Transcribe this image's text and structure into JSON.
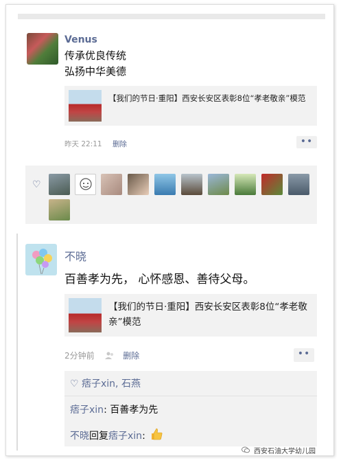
{
  "post1": {
    "username": "Venus",
    "text_line1": "传承优良传统",
    "text_line2": "弘扬中华美德",
    "link_title": "【我们的节日·重阳】西安长安区表彰8位“孝老敬亲”模范",
    "time": "昨天 22:11",
    "delete": "删除",
    "more": "••"
  },
  "likes1": {
    "icon": "heart-outline-icon",
    "count": 11
  },
  "post2": {
    "username": "不晓",
    "text": "百善孝为先， 心怀感恩、善待父母。",
    "link_title": "【我们的节日·重阳】西安长安区表彰8位“孝老敬亲”模范",
    "time": "2分钟前",
    "delete": "删除",
    "more": "••"
  },
  "comments": {
    "likes_text": "♡ 痞子xin, 石燕",
    "c1_name": "痞子xin",
    "c1_text": ": 百善孝为先",
    "c2_name1": "不晓",
    "c2_mid": "回复",
    "c2_name2": "痞子xin",
    "c2_colon": ":"
  },
  "watermark": "西安石油大学幼儿园",
  "colors": {
    "name_link": "#5b6b94",
    "panel_bg": "#f2f2f2",
    "meta_gray": "#999999"
  }
}
